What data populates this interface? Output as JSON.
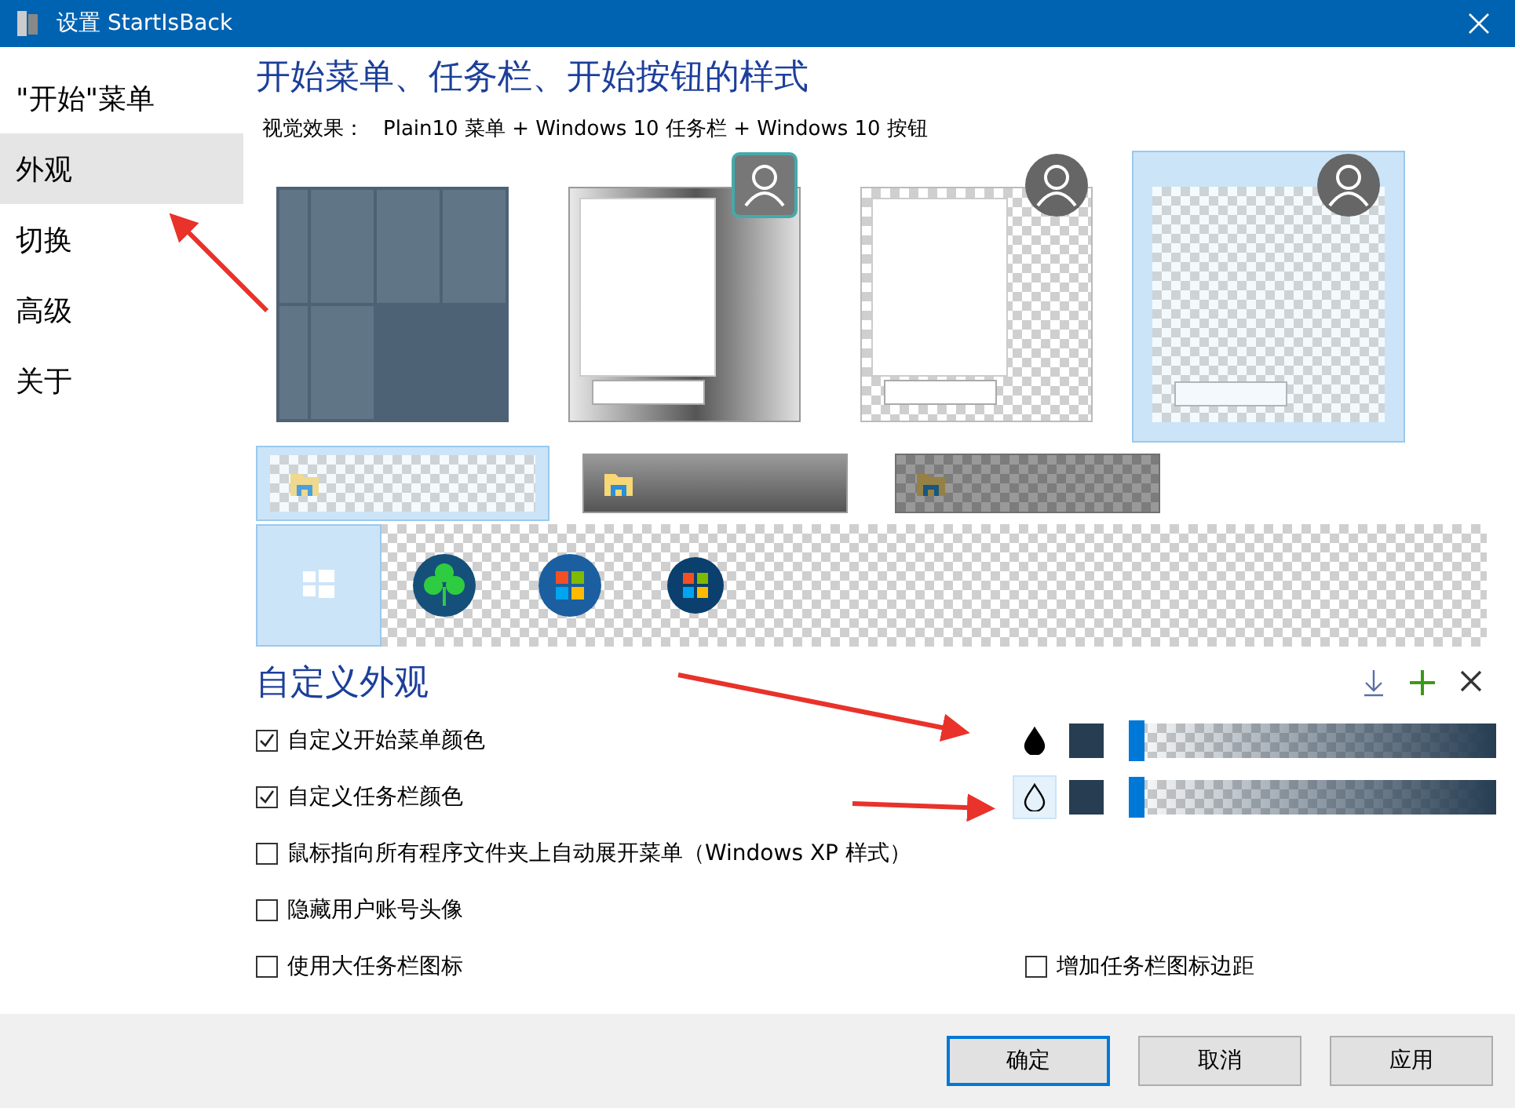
{
  "window": {
    "title": "设置 StartIsBack"
  },
  "sidebar": {
    "items": [
      {
        "label": "\"开始\"菜单",
        "selected": false
      },
      {
        "label": "外观",
        "selected": true
      },
      {
        "label": "切换",
        "selected": false
      },
      {
        "label": "高级",
        "selected": false
      },
      {
        "label": "关于",
        "selected": false
      }
    ]
  },
  "styles": {
    "heading": "开始菜单、任务栏、开始按钮的样式",
    "visual_effect_label": "视觉效果：",
    "visual_effect_value": "Plain10 菜单 + Windows 10 任务栏 + Windows 10 按钮",
    "menu_styles": [
      {
        "kind": "tiles",
        "selected": false
      },
      {
        "kind": "aero",
        "selected": false
      },
      {
        "kind": "flat",
        "selected": false
      },
      {
        "kind": "clear",
        "selected": true
      }
    ],
    "taskbar_styles": [
      {
        "kind": "clear",
        "selected": true
      },
      {
        "kind": "aero",
        "selected": false
      },
      {
        "kind": "flat",
        "selected": false
      }
    ],
    "button_styles": [
      {
        "kind": "windows10",
        "selected": true
      },
      {
        "kind": "clover",
        "selected": false
      },
      {
        "kind": "windows7",
        "selected": false
      },
      {
        "kind": "windows8",
        "selected": false
      }
    ]
  },
  "custom": {
    "heading": "自定义外观",
    "options": [
      {
        "label": "自定义开始菜单颜色",
        "checked": true,
        "color_control": {
          "kind": "filled",
          "selected": false,
          "color": "#263d52",
          "level": 0
        }
      },
      {
        "label": "自定义任务栏颜色",
        "checked": true,
        "color_control": {
          "kind": "outline",
          "selected": true,
          "color": "#263d52",
          "level": 0
        }
      },
      {
        "label": "鼠标指向所有程序文件夹上自动展开菜单（Windows XP 样式）",
        "checked": false
      },
      {
        "label": "隐藏用户账号头像",
        "checked": false
      },
      {
        "label": "使用大任务栏图标",
        "checked": false,
        "right_option": {
          "label": "增加任务栏图标边距",
          "checked": false
        }
      }
    ]
  },
  "buttons": [
    {
      "label": "确定",
      "default": true
    },
    {
      "label": "取消",
      "default": false
    },
    {
      "label": "应用",
      "default": false
    }
  ]
}
